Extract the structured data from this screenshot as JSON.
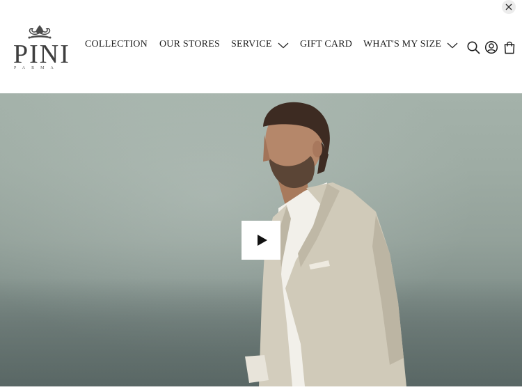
{
  "brand": {
    "wordmark": "PINI",
    "sub": "PARMA",
    "crest_icon": "fleur-crest-icon"
  },
  "nav": {
    "items": [
      {
        "label": "COLLECTION",
        "has_dropdown": false
      },
      {
        "label": "OUR STORES",
        "has_dropdown": false
      },
      {
        "label": "SERVICE",
        "has_dropdown": true
      },
      {
        "label": "GIFT CARD",
        "has_dropdown": false
      },
      {
        "label": "WHAT'S MY SIZE",
        "has_dropdown": true
      }
    ]
  },
  "utility": {
    "icons": [
      "search-icon",
      "account-icon",
      "cart-icon"
    ]
  },
  "hero": {
    "media": "video",
    "play_icon": "play-icon"
  },
  "overlay": {
    "close_icon": "close-icon"
  },
  "colors": {
    "text": "#1f1f1f",
    "header_bg": "#ffffff",
    "hero_sky": "#a4b2aa",
    "hero_sea": "#6d7b78",
    "jacket": "#cfc9b9"
  }
}
